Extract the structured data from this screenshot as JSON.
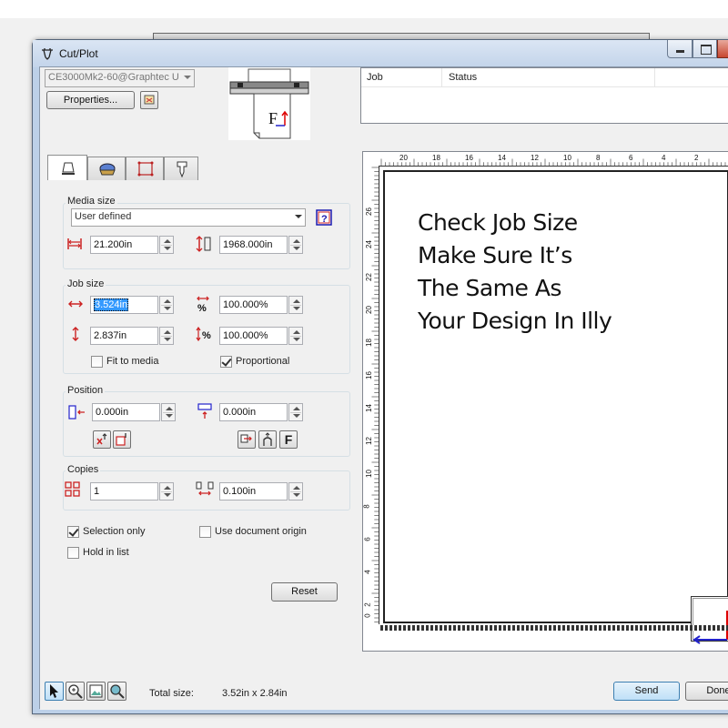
{
  "window": {
    "title": "Cut/Plot"
  },
  "device": {
    "selected": "CE3000Mk2-60@Graphtec U",
    "properties_label": "Properties..."
  },
  "job_list": {
    "columns": [
      "Job",
      "Status"
    ]
  },
  "tabs": [
    {
      "icon": "general-tab-icon"
    },
    {
      "icon": "weed-tab-icon"
    },
    {
      "icon": "frame-tab-icon"
    },
    {
      "icon": "tool-tab-icon"
    }
  ],
  "media_size": {
    "label": "Media size",
    "type": "User defined",
    "width": "21.200in",
    "length": "1968.000in"
  },
  "job_size": {
    "label": "Job size",
    "width": "3.524in",
    "width_scale": "100.000%",
    "height": "2.837in",
    "height_scale": "100.000%",
    "fit_to_media": "Fit to media",
    "fit_to_media_checked": false,
    "proportional": "Proportional",
    "proportional_checked": true
  },
  "position": {
    "label": "Position",
    "x": "0.000in",
    "y": "0.000in",
    "flip_label": "F"
  },
  "copies": {
    "label": "Copies",
    "count": "1",
    "spacing": "0.100in"
  },
  "options": {
    "selection_only": "Selection only",
    "selection_only_checked": true,
    "use_document_origin": "Use document origin",
    "use_document_origin_checked": false,
    "hold_in_list": "Hold in list",
    "hold_in_list_checked": false
  },
  "reset_label": "Reset",
  "preview": {
    "h_ruler_labels": [
      "20",
      "18",
      "16",
      "14",
      "12",
      "10",
      "8",
      "6",
      "4",
      "2"
    ],
    "v_ruler_labels": [
      "26",
      "24",
      "22",
      "20",
      "18",
      "16",
      "14",
      "12",
      "10",
      "8",
      "6",
      "4",
      "2",
      "0"
    ]
  },
  "annotation": {
    "lines": [
      "Check Job Size",
      "Make Sure It’s",
      "The Same As",
      "Your Design In Illy"
    ]
  },
  "status": {
    "total_size_label": "Total size:",
    "total_size_value": "3.52in x 2.84in",
    "send_label": "Send",
    "done_label": "Done"
  }
}
